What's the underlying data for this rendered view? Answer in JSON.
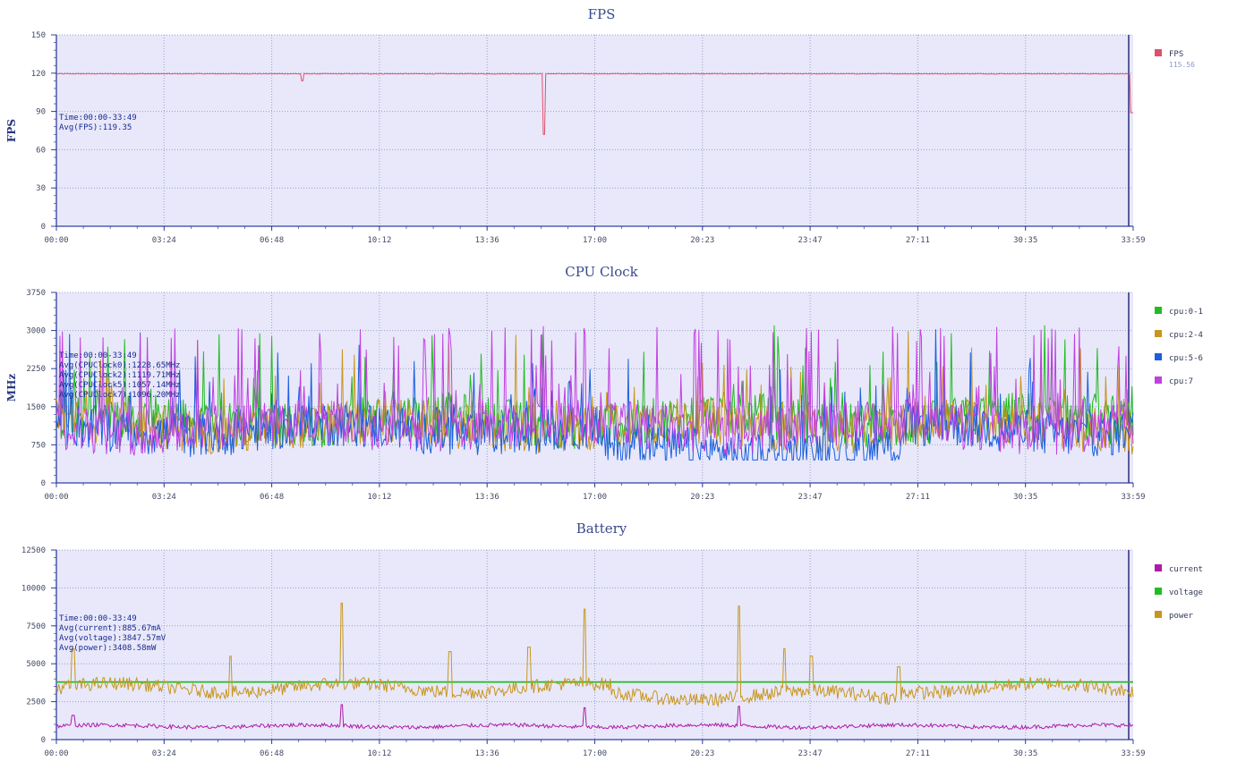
{
  "chart_data": [
    {
      "type": "line",
      "title": "FPS",
      "ylabel": "FPS",
      "ylim": [
        0,
        150
      ],
      "yticks": [
        0,
        30,
        60,
        90,
        120,
        150
      ],
      "xlim_seconds": [
        0,
        2039
      ],
      "xticks": [
        "00:00",
        "03:24",
        "06:48",
        "10:12",
        "13:36",
        "17:00",
        "20:23",
        "23:47",
        "27:11",
        "30:35",
        "33:59"
      ],
      "info": [
        "Time:00:00-33:49",
        "Avg(FPS):119.35"
      ],
      "legend": [
        {
          "name": "FPS",
          "sub": "115.56"
        }
      ],
      "colors": {
        "FPS": "#e0506a"
      },
      "series": [
        {
          "name": "FPS",
          "base": 119.5,
          "noise": 0.6,
          "events": [
            [
              465,
              114
            ],
            [
              923,
              72
            ],
            [
              2037,
              89
            ]
          ]
        }
      ]
    },
    {
      "type": "line",
      "title": "CPU Clock",
      "ylabel": "MHz",
      "ylim": [
        0,
        3750
      ],
      "yticks": [
        0,
        750,
        1500,
        2250,
        3000,
        3750
      ],
      "xlim_seconds": [
        0,
        2039
      ],
      "xticks": [
        "00:00",
        "03:24",
        "06:48",
        "10:12",
        "13:36",
        "17:00",
        "20:23",
        "23:47",
        "27:11",
        "30:35",
        "33:59"
      ],
      "info": [
        "Time:00:00-33:49",
        "Avg(CPUClock0):1228.65MHz",
        "Avg(CPUClock2):1119.71MHz",
        "Avg(CPUClock5):1057.14MHz",
        "Avg(CPUClock7):1096.20MHz"
      ],
      "legend": [
        {
          "name": "cpu:0-1"
        },
        {
          "name": "cpu:2-4"
        },
        {
          "name": "cpu:5-6"
        },
        {
          "name": "cpu:7"
        }
      ],
      "colors": {
        "cpu:0-1": "#22bb22",
        "cpu:2-4": "#c8961e",
        "cpu:5-6": "#1a5fe0",
        "cpu:7": "#c040e0"
      },
      "series": [
        {
          "name": "cpu:0-1",
          "avg": 1228.65
        },
        {
          "name": "cpu:2-4",
          "avg": 1119.71
        },
        {
          "name": "cpu:5-6",
          "avg": 1057.14
        },
        {
          "name": "cpu:7",
          "avg": 1096.2
        }
      ]
    },
    {
      "type": "line",
      "title": "Battery",
      "ylabel": "",
      "ylim": [
        0,
        12500
      ],
      "yticks": [
        0,
        2500,
        5000,
        7500,
        10000,
        12500
      ],
      "xlim_seconds": [
        0,
        2039
      ],
      "xticks": [
        "00:00",
        "03:24",
        "06:48",
        "10:12",
        "13:36",
        "17:00",
        "20:23",
        "23:47",
        "27:11",
        "30:35",
        "33:59"
      ],
      "info": [
        "Time:00:00-33:49",
        "Avg(current):885.67mA",
        "Avg(voltage):3847.57mV",
        "Avg(power):3408.58mW"
      ],
      "legend": [
        {
          "name": "current"
        },
        {
          "name": "voltage"
        },
        {
          "name": "power"
        }
      ],
      "colors": {
        "current": "#b01aa8",
        "voltage": "#22bb22",
        "power": "#c8961e"
      },
      "series": [
        {
          "name": "current",
          "avg": 885.67,
          "events": [
            [
              32,
              1600
            ],
            [
              540,
              2300
            ],
            [
              1000,
              2100
            ],
            [
              1293,
              2200
            ]
          ]
        },
        {
          "name": "voltage",
          "avg": 3847.57
        },
        {
          "name": "power",
          "avg": 3408.58,
          "events": [
            [
              32,
              6000
            ],
            [
              330,
              5500
            ],
            [
              540,
              9000
            ],
            [
              745,
              5800
            ],
            [
              895,
              6100
            ],
            [
              1000,
              8600
            ],
            [
              1293,
              8800
            ],
            [
              1378,
              6000
            ],
            [
              1430,
              5500
            ],
            [
              1595,
              4800
            ]
          ]
        }
      ]
    }
  ]
}
